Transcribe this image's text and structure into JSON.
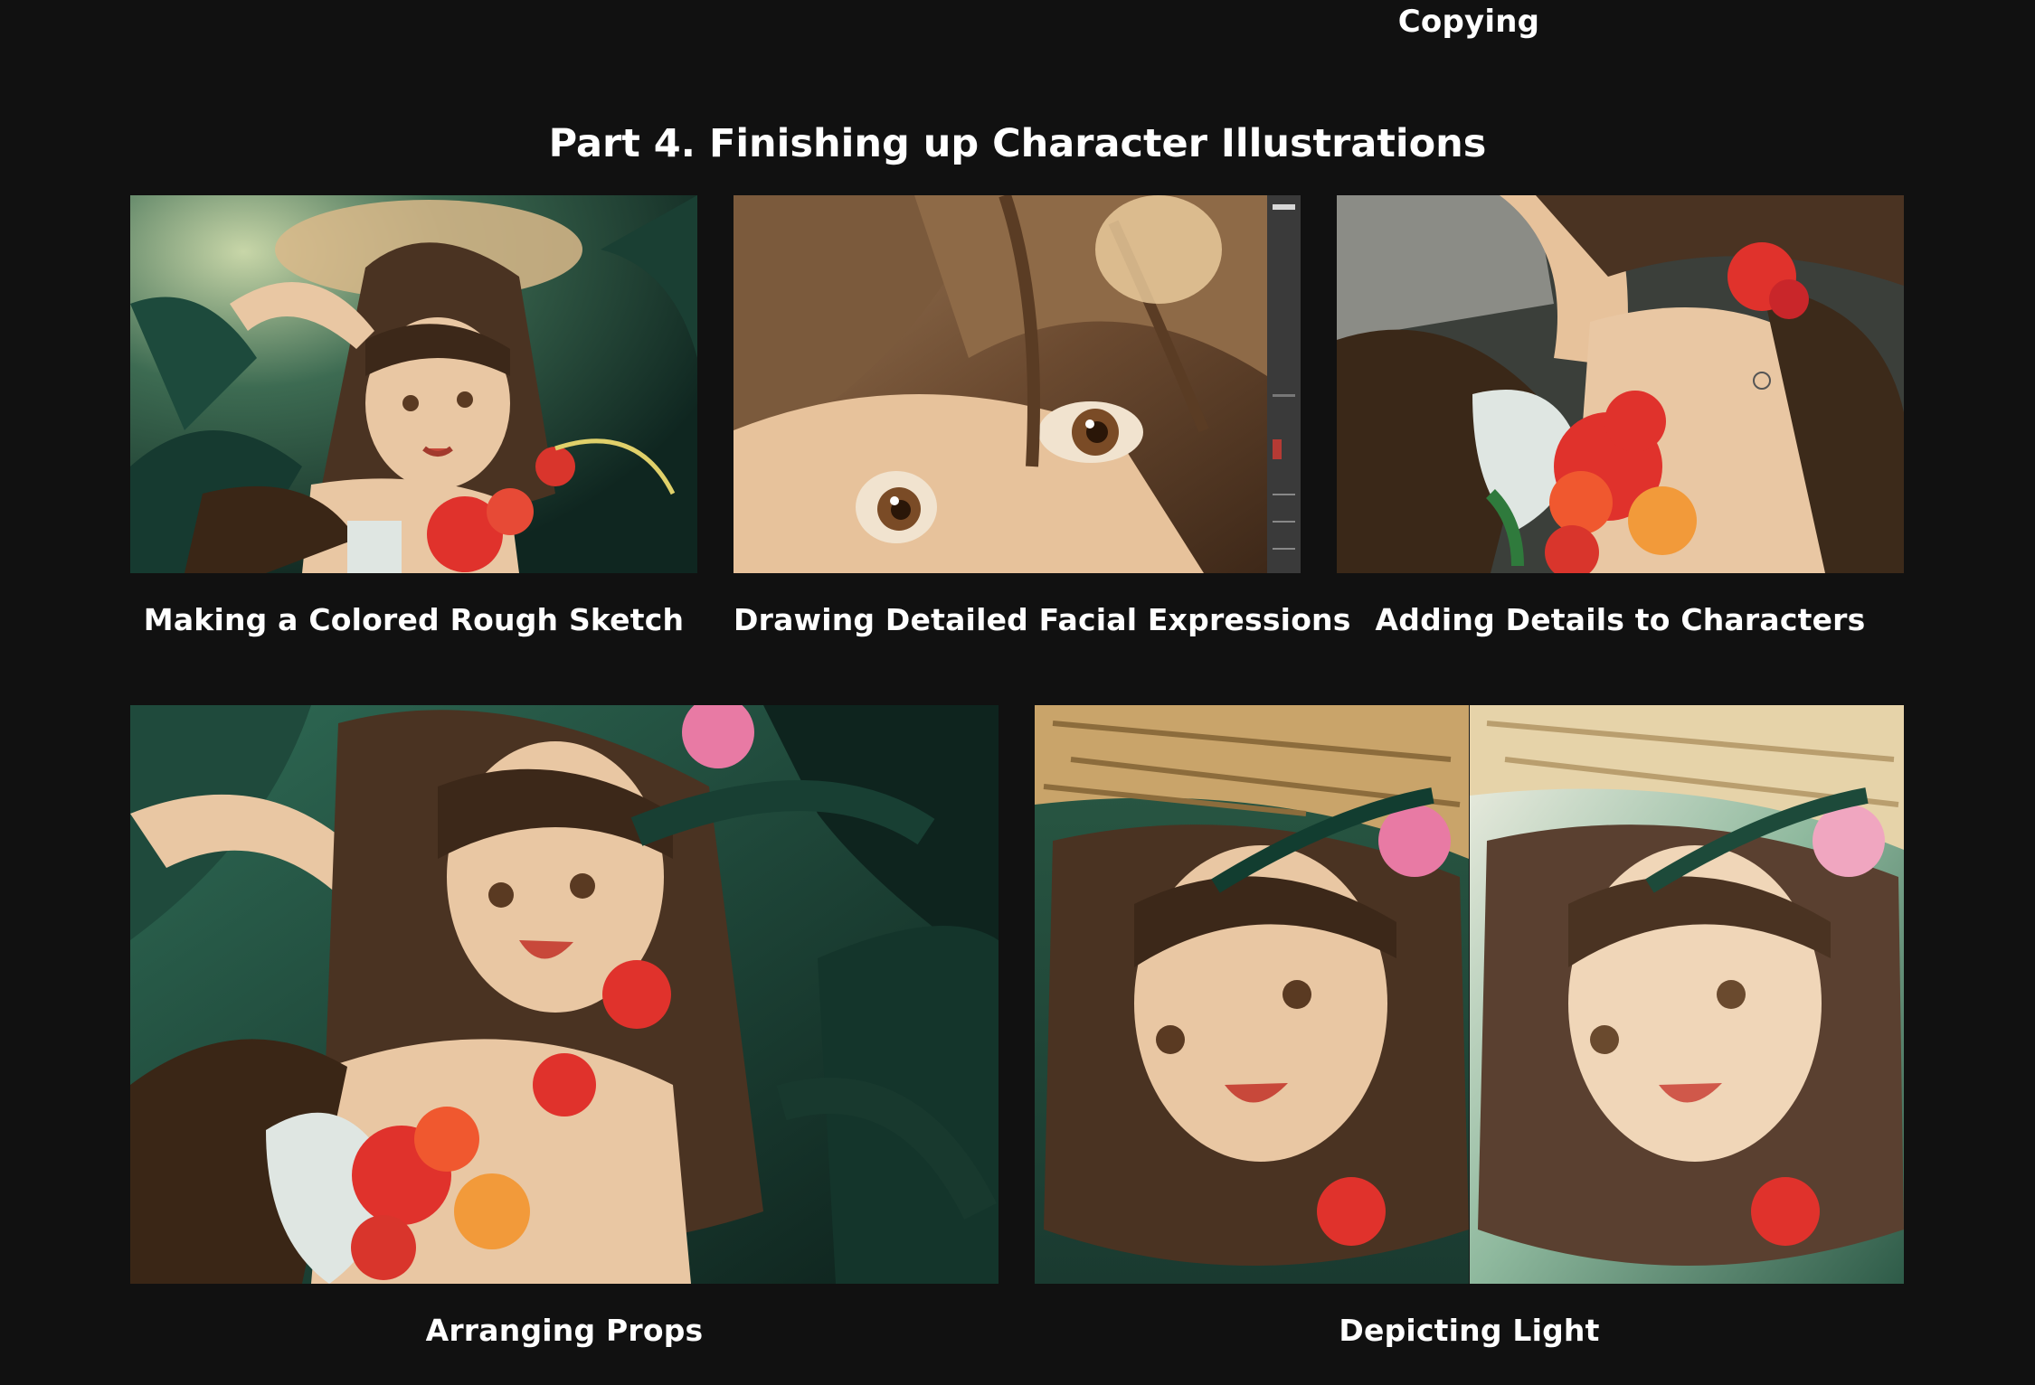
{
  "header": {
    "top_caption": "Copying",
    "section_title": "Part 4. Finishing up Character Illustrations"
  },
  "tiles": [
    {
      "caption": "Making a Colored Rough Sketch"
    },
    {
      "caption": "Drawing Detailed Facial Expressions"
    },
    {
      "caption": "Adding Details to Characters"
    },
    {
      "caption": "Arranging Props"
    },
    {
      "caption": "Depicting Light"
    }
  ],
  "colors": {
    "background": "#111111",
    "text": "#ffffff",
    "foliage_dark": "#12302b",
    "foliage_mid": "#2f6b55",
    "hair": "#4a3322",
    "skin": "#e9c7a3",
    "hibiscus_red": "#e0322c",
    "hibiscus_pink": "#e87aa4",
    "straw_hat": "#c9a46a"
  }
}
